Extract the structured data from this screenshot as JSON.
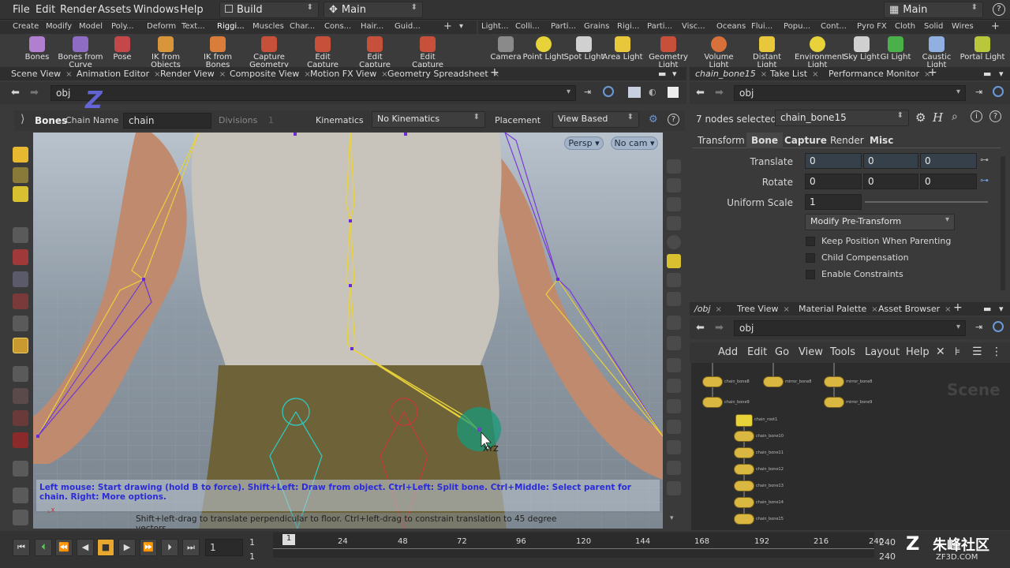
{
  "menubar": {
    "items": [
      "File",
      "Edit",
      "Render",
      "Assets",
      "Windows",
      "Help"
    ],
    "desktop": "Build",
    "context": "Main",
    "right_desktop": "Main",
    "help": "?"
  },
  "shelf_left": {
    "tabs": [
      "Create",
      "Modify",
      "Model",
      "Poly...",
      "Deform",
      "Text...",
      "Riggi...",
      "Muscles",
      "Char...",
      "Cons...",
      "Hair...",
      "Guid..."
    ],
    "tools": [
      {
        "label": "Bones",
        "icon": "bones-icon"
      },
      {
        "label": "Bones from Curve",
        "icon": "bones-from-curve-icon"
      },
      {
        "label": "Pose",
        "icon": "pose-icon"
      },
      {
        "label": "IK from Objects",
        "icon": "ik-from-objects-icon"
      },
      {
        "label": "IK from Bones",
        "icon": "ik-from-bones-icon"
      },
      {
        "label": "Capture Geometry",
        "icon": "capture-geometry-icon"
      },
      {
        "label": "Edit Capture Regions",
        "icon": "edit-capture-regions-icon"
      },
      {
        "label": "Edit Capture Weights",
        "icon": "edit-capture-weights-icon"
      },
      {
        "label": "Edit Capture Blends",
        "icon": "edit-capture-blends-icon"
      }
    ]
  },
  "shelf_right": {
    "tabs": [
      "Light...",
      "Colli...",
      "Parti...",
      "Grains",
      "Rigi...",
      "Parti...",
      "Visc...",
      "Oceans",
      "Flui...",
      "Popu...",
      "Cont...",
      "Pyro FX",
      "Cloth",
      "Solid",
      "Wires"
    ],
    "tools": [
      {
        "label": "Camera",
        "icon": "camera-icon"
      },
      {
        "label": "Point Light",
        "icon": "point-light-icon"
      },
      {
        "label": "Spot Light",
        "icon": "spot-light-icon"
      },
      {
        "label": "Area Light",
        "icon": "area-light-icon"
      },
      {
        "label": "Geometry Light",
        "icon": "geometry-light-icon"
      },
      {
        "label": "Volume Light",
        "icon": "volume-light-icon"
      },
      {
        "label": "Distant Light",
        "icon": "distant-light-icon"
      },
      {
        "label": "Environment Light",
        "icon": "environment-light-icon"
      },
      {
        "label": "Sky Light",
        "icon": "sky-light-icon"
      },
      {
        "label": "GI Light",
        "icon": "gi-light-icon"
      },
      {
        "label": "Caustic Light",
        "icon": "caustic-light-icon"
      },
      {
        "label": "Portal Light",
        "icon": "portal-light-icon"
      }
    ]
  },
  "left_tabs": [
    "Scene View",
    "Animation Editor",
    "Render View",
    "Composite View",
    "Motion FX View",
    "Geometry Spreadsheet"
  ],
  "left_path": "obj",
  "operator_bar": {
    "tool": "Bones",
    "chain_name_label": "Chain Name",
    "chain_name_value": "chain",
    "divisions_label": "Divisions",
    "divisions_value": "1",
    "kinematics_label": "Kinematics",
    "kinematics_value": "No Kinematics",
    "placement_label": "Placement",
    "placement_value": "View Based"
  },
  "viewport": {
    "persp": "Persp",
    "cam": "No cam",
    "handle_label": "XYZ",
    "hint": "Left mouse: Start drawing (hold B to force). Shift+Left: Draw from object. Ctrl+Left: Split bone. Ctrl+Middle: Select parent for chain. Right: More options.",
    "status": "Shift+left-drag to translate perpendicular to floor. Ctrl+left-drag to constrain translation to 45 degree vectors.",
    "overlay_letter": "Z"
  },
  "right_top_tabs": [
    "chain_bone15",
    "Take List",
    "Performance Monitor"
  ],
  "right_top_path": "obj",
  "params": {
    "selected_label": "7 nodes selected:",
    "selected_node": "chain_bone15",
    "tabs": [
      "Transform",
      "Bone",
      "Capture",
      "Render",
      "Misc"
    ],
    "translate_label": "Translate",
    "translate": [
      "0",
      "0",
      "0"
    ],
    "rotate_label": "Rotate",
    "rotate": [
      "0",
      "0",
      "0"
    ],
    "uniform_scale_label": "Uniform Scale",
    "uniform_scale": "1",
    "modify_pre_transform": "Modify Pre-Transform",
    "checkboxes": [
      "Keep Position When Parenting",
      "Child Compensation",
      "Enable Constraints"
    ]
  },
  "right_bottom_tabs": [
    "/obj",
    "Tree View",
    "Material Palette",
    "Asset Browser"
  ],
  "right_bottom_path": "obj",
  "network_menu": [
    "Add",
    "Edit",
    "Go",
    "View",
    "Tools",
    "Layout",
    "Help"
  ],
  "network": {
    "watermark": "Scene",
    "nodes": [
      {
        "label": "chain_bone8"
      },
      {
        "label": "mirror_bone8"
      },
      {
        "label": "mirror_bone8"
      },
      {
        "label": "chain_bone9"
      },
      {
        "label": "mirror_bone9"
      },
      {
        "label": "chain_root1"
      },
      {
        "label": "chain_bone10"
      },
      {
        "label": "chain_bone11"
      },
      {
        "label": "chain_bone12"
      },
      {
        "label": "chain_bone13"
      },
      {
        "label": "chain_bone14"
      },
      {
        "label": "chain_bone15"
      }
    ]
  },
  "timeline": {
    "current_frame": "1",
    "start": "1",
    "start2": "1",
    "ticks": [
      "1",
      "24",
      "48",
      "72",
      "96",
      "120",
      "144",
      "168",
      "192",
      "216",
      "240"
    ],
    "end": "240",
    "end2": "240",
    "watermark": "朱峰社区",
    "watermark_url": "ZF3D.COM"
  },
  "colors": {
    "accent": "#f0b830",
    "bone_yellow": "#e8d23a",
    "bone_purple": "#7a3ad8",
    "hint_text": "#2b2bd8"
  }
}
